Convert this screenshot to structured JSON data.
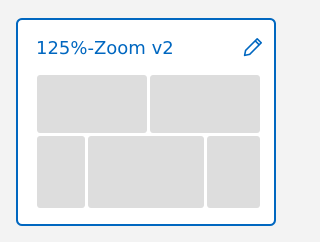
{
  "card": {
    "title": "125%-Zoom v2",
    "edit_icon": "pencil-icon",
    "accent_color": "#0067c0",
    "zone_color": "#dddddd",
    "zones": [
      "zone-1",
      "zone-2",
      "zone-3",
      "zone-4",
      "zone-5"
    ]
  }
}
